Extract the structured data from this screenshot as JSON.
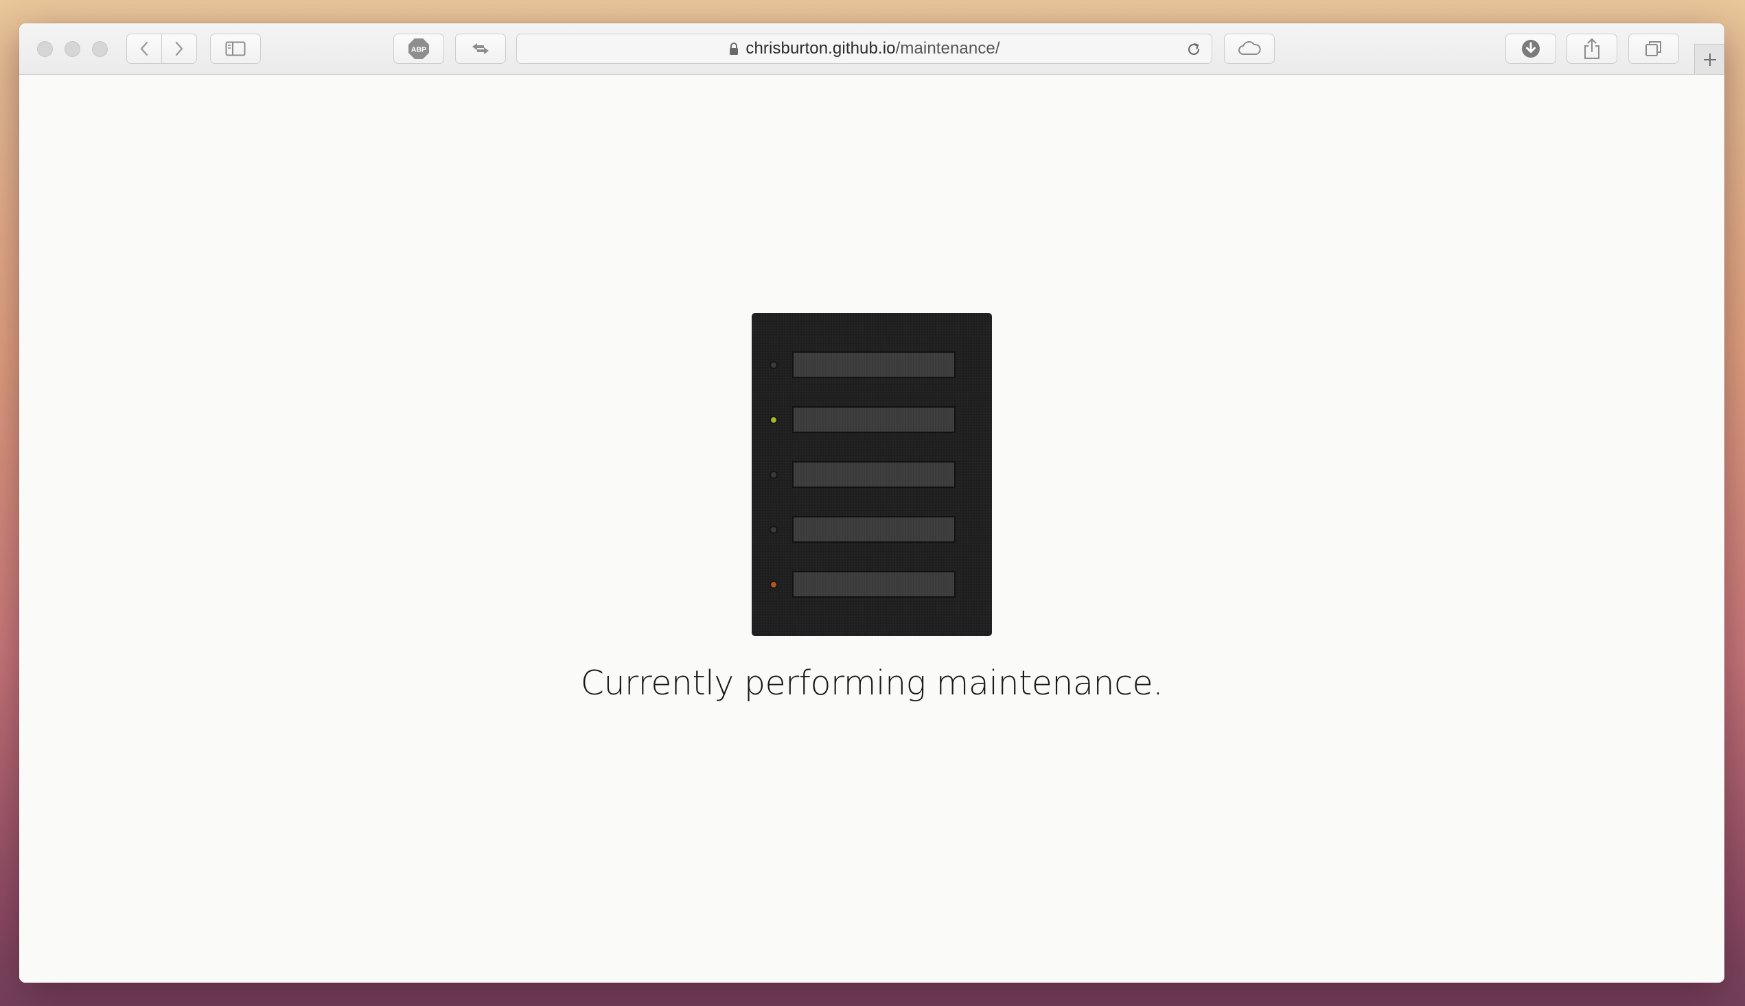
{
  "browser": {
    "url_host": "chrisburton.github.io",
    "url_path": "/maintenance/",
    "toolbar_icons": {
      "back": "chevron-left-icon",
      "forward": "chevron-right-icon",
      "sidebar": "sidebar-icon",
      "adblock": "abp-icon",
      "extension": "swap-arrows-icon",
      "reload": "reload-icon",
      "cloud": "cloud-icon",
      "downloads": "download-icon",
      "share": "share-icon",
      "tabs": "tabs-overview-icon",
      "new_tab": "plus-icon"
    },
    "adblock_label": "ABP"
  },
  "page": {
    "message": "Currently performing maintenance."
  },
  "server_illustration": {
    "icon": "server-rack-icon",
    "drive_count": 5,
    "led_colors": [
      "#3a3a3a",
      "#a6b52a",
      "#3a3a3a",
      "#3a3a3a",
      "#b5561e"
    ]
  }
}
